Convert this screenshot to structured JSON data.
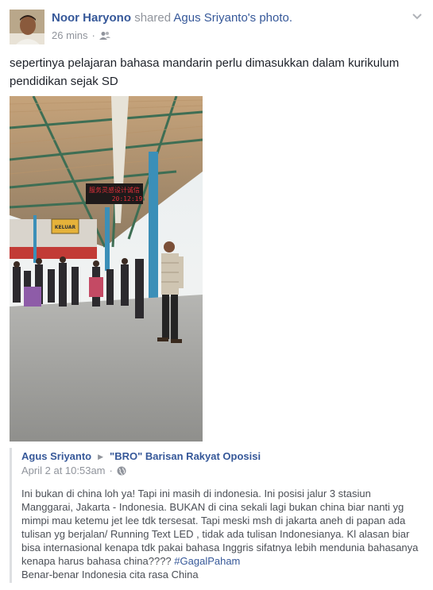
{
  "post": {
    "author": "Noor Haryono",
    "action": "shared",
    "shared_from": "Agus Sriyanto's photo.",
    "time": "26 mins",
    "separator": "·",
    "audience_icon": "friends-icon",
    "menu_icon": "chevron-down-icon",
    "message": "sepertinya pelajaran bahasa mandarin perlu dimasukkan dalam kurikulum pendidikan sejak SD"
  },
  "photo": {
    "led_line1": "服务灵感设计诚信",
    "led_line2": "20:12:19",
    "exit_sign": "KELUAR"
  },
  "shared": {
    "author": "Agus Sriyanto",
    "arrow": "▶",
    "group": "\"BRO\" Barisan Rakyat Oposisi",
    "time": "April 2 at 10:53am",
    "separator": "·",
    "audience_icon": "globe-icon",
    "body": "Ini bukan di china loh ya! Tapi ini masih di indonesia. Ini posisi jalur 3 stasiun Manggarai, Jakarta - Indonesia. BUKAN di cina sekali lagi bukan china biar nanti yg mimpi mau ketemu jet lee tdk tersesat. Tapi meski msh di jakarta aneh di papan ada tulisan yg berjalan/ Running Text LED , tidak ada tulisan Indonesianya. Kl alasan biar bisa internasional kenapa tdk pakai bahasa Inggris sifatnya lebih mendunia bahasanya kenapa harus bahasa china????",
    "hashtag": "#GagalPaham",
    "closing": "Benar-benar Indonesia cita rasa China"
  },
  "colors": {
    "link": "#365899",
    "meta": "#90949c",
    "text": "#1d2129",
    "body": "#4b4f56",
    "led": "#e0303a"
  }
}
